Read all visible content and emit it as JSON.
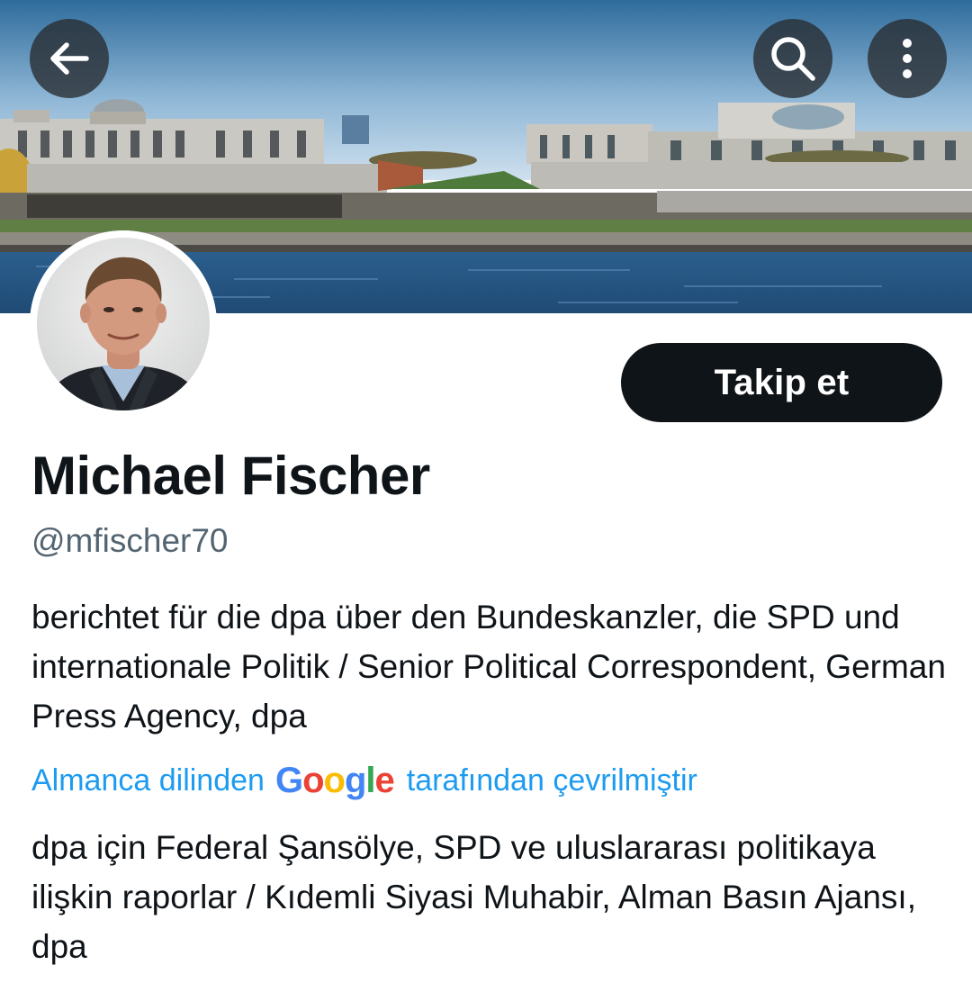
{
  "header": {
    "back_icon": "arrow-left-icon",
    "search_icon": "search-icon",
    "more_icon": "more-vertical-icon"
  },
  "profile": {
    "display_name": "Michael Fischer",
    "handle": "@mfischer70",
    "follow_label": "Takip et",
    "bio": "berichtet für die dpa über den Bundeskanzler, die SPD und internationale Politik / Senior Political Correspondent, German Press Agency, dpa",
    "translation_prefix": "Almanca dilinden",
    "translation_provider": [
      "G",
      "o",
      "o",
      "g",
      "l",
      "e"
    ],
    "translation_suffix": "tarafından çevrilmiştir",
    "translated_bio": "dpa için Federal Şansölye, SPD ve uluslararası politikaya ilişkin raporlar / Kıdemli Siyasi Muhabir, Alman Basın Ajansı, dpa"
  },
  "colors": {
    "text_primary": "#0f1419",
    "text_secondary": "#536471",
    "link": "#1d9bf0",
    "button_bg": "#0f1419",
    "button_text": "#ffffff"
  }
}
